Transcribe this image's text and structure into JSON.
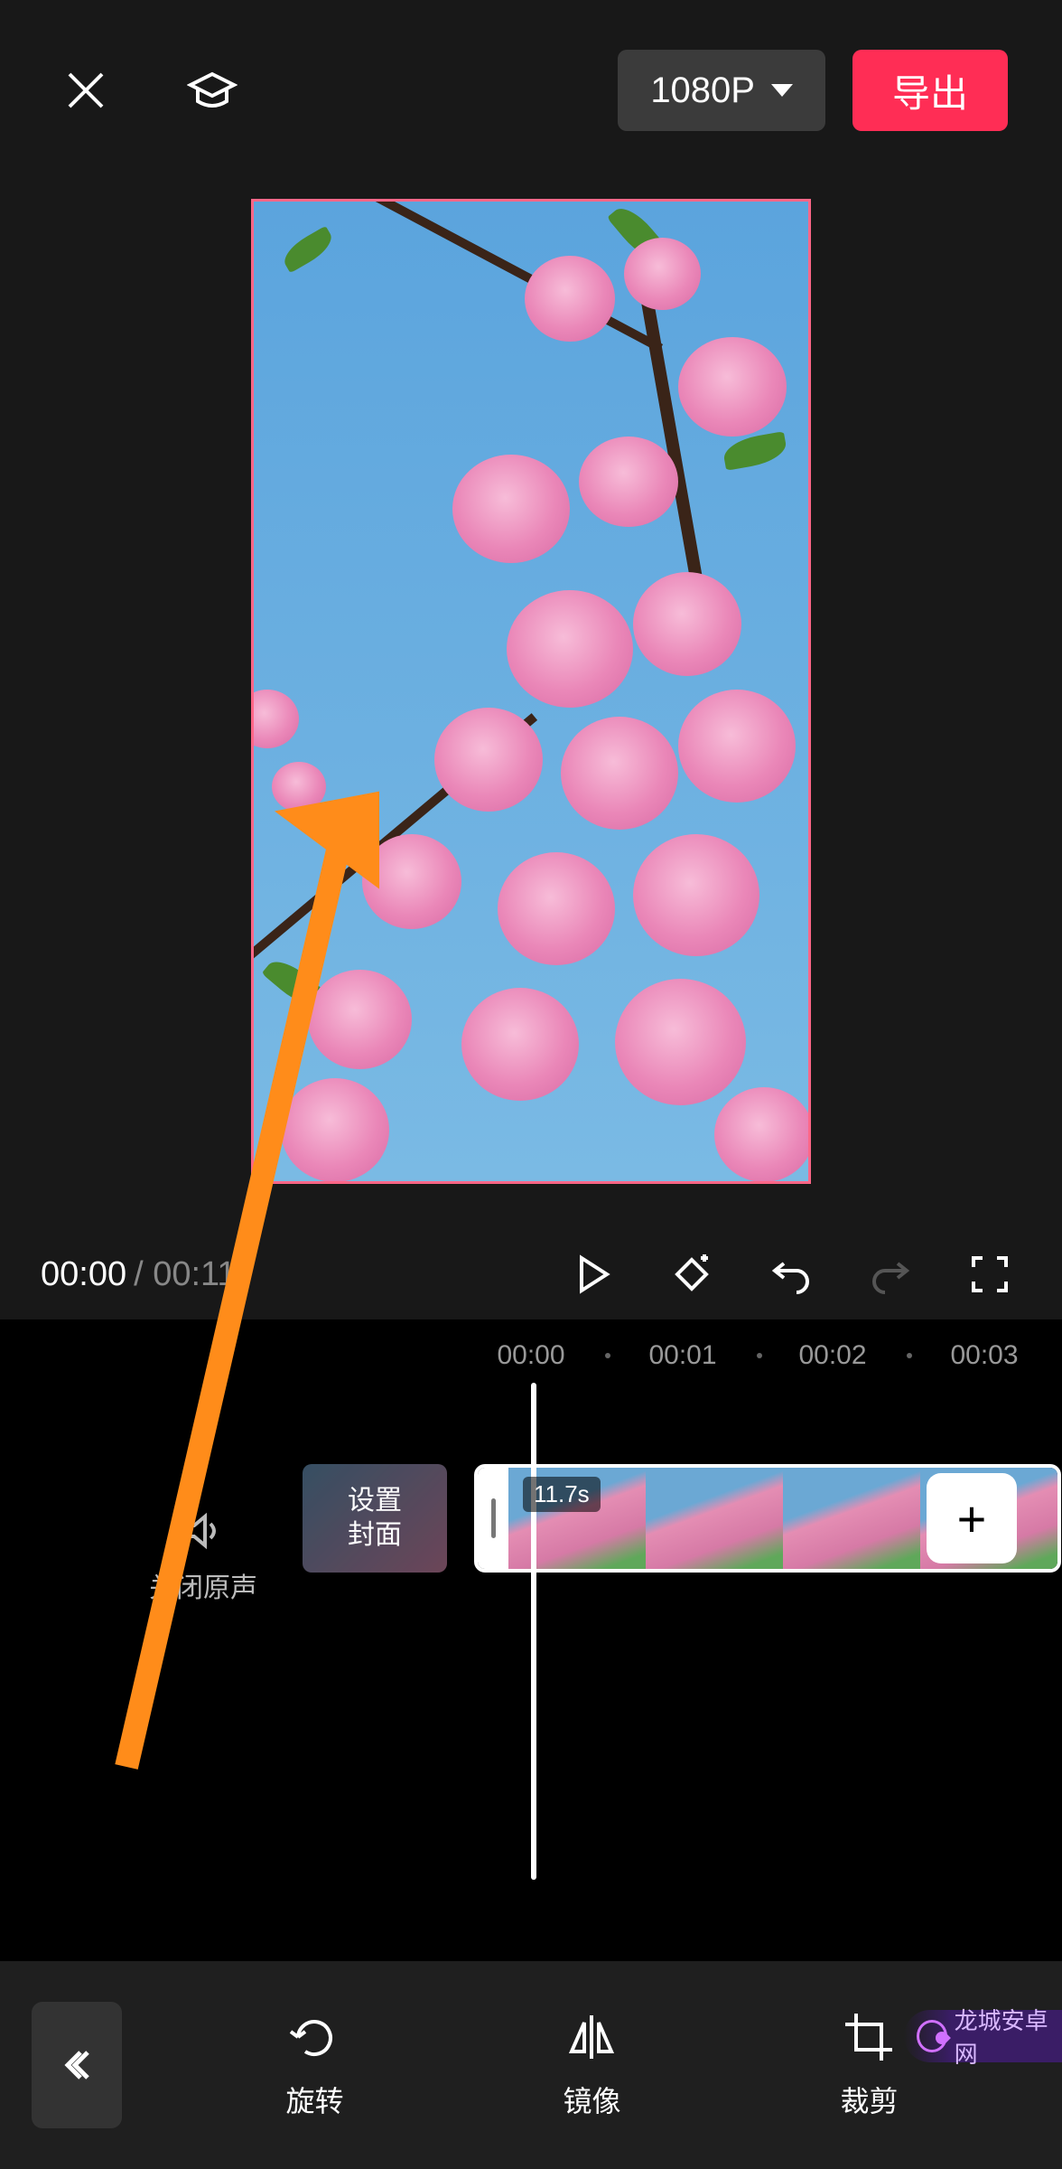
{
  "header": {
    "resolution": "1080P",
    "export_label": "导出"
  },
  "playbar": {
    "current_time": "00:00",
    "total_time": " / 00:11"
  },
  "ruler": {
    "t0": "00:00",
    "t1": "00:01",
    "t2": "00:02",
    "t3": "00:03"
  },
  "timeline": {
    "mute_label": "关闭原声",
    "cover_label": "设置\n封面",
    "clip_duration": "11.7s",
    "add_label": "+"
  },
  "toolbar": {
    "rotate": "旋转",
    "mirror": "镜像",
    "crop": "裁剪"
  },
  "watermark": "龙城安卓网"
}
